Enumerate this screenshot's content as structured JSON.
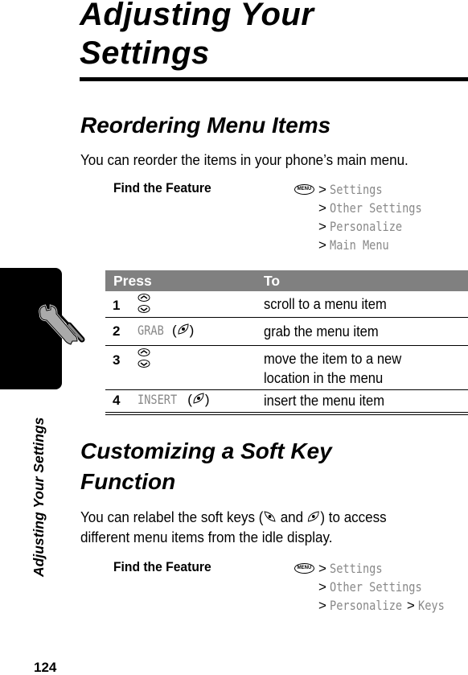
{
  "page": {
    "title": "Adjusting Your Settings",
    "title_line1": "Adjusting Your",
    "title_line2": "Settings",
    "page_number": "124",
    "sidebar_title": "Adjusting Your Settings",
    "sidebar_icon": "wrench-screwdriver-icon"
  },
  "section1": {
    "heading": "Reordering Menu Items",
    "body": "You can reorder the items in your phone’s main menu.",
    "find_the_feature": {
      "label": "Find the Feature",
      "menu_key": "MENU",
      "path": [
        "Settings",
        "Other Settings",
        "Personalize",
        "Main Menu"
      ]
    },
    "table": {
      "headers": [
        "Press",
        "To"
      ],
      "rows": [
        {
          "num": "1",
          "key": "",
          "key_icon": "nav-up-down-icon",
          "desc": "scroll to a menu item"
        },
        {
          "num": "2",
          "key": "GRAB",
          "key_icon": "right-soft-key-icon",
          "desc": "grab the menu item"
        },
        {
          "num": "3",
          "key": "",
          "key_icon": "nav-up-down-icon",
          "desc_line1": "move the item to a new",
          "desc_line2": "location in the menu"
        },
        {
          "num": "4",
          "key": "INSERT",
          "key_icon": "right-soft-key-icon",
          "desc": "insert the menu item"
        }
      ]
    }
  },
  "section2": {
    "heading_line1": "Customizing a Soft Key",
    "heading_line2": "Function",
    "body_part1": "You can relabel the soft keys (",
    "body_and": "and",
    "body_part2": ") to access",
    "body_line2": "different menu items from the idle display.",
    "find_the_feature": {
      "label": "Find the Feature",
      "menu_key": "MENU",
      "path": [
        "Settings",
        "Other Settings",
        "Personalize",
        "Keys"
      ]
    }
  }
}
